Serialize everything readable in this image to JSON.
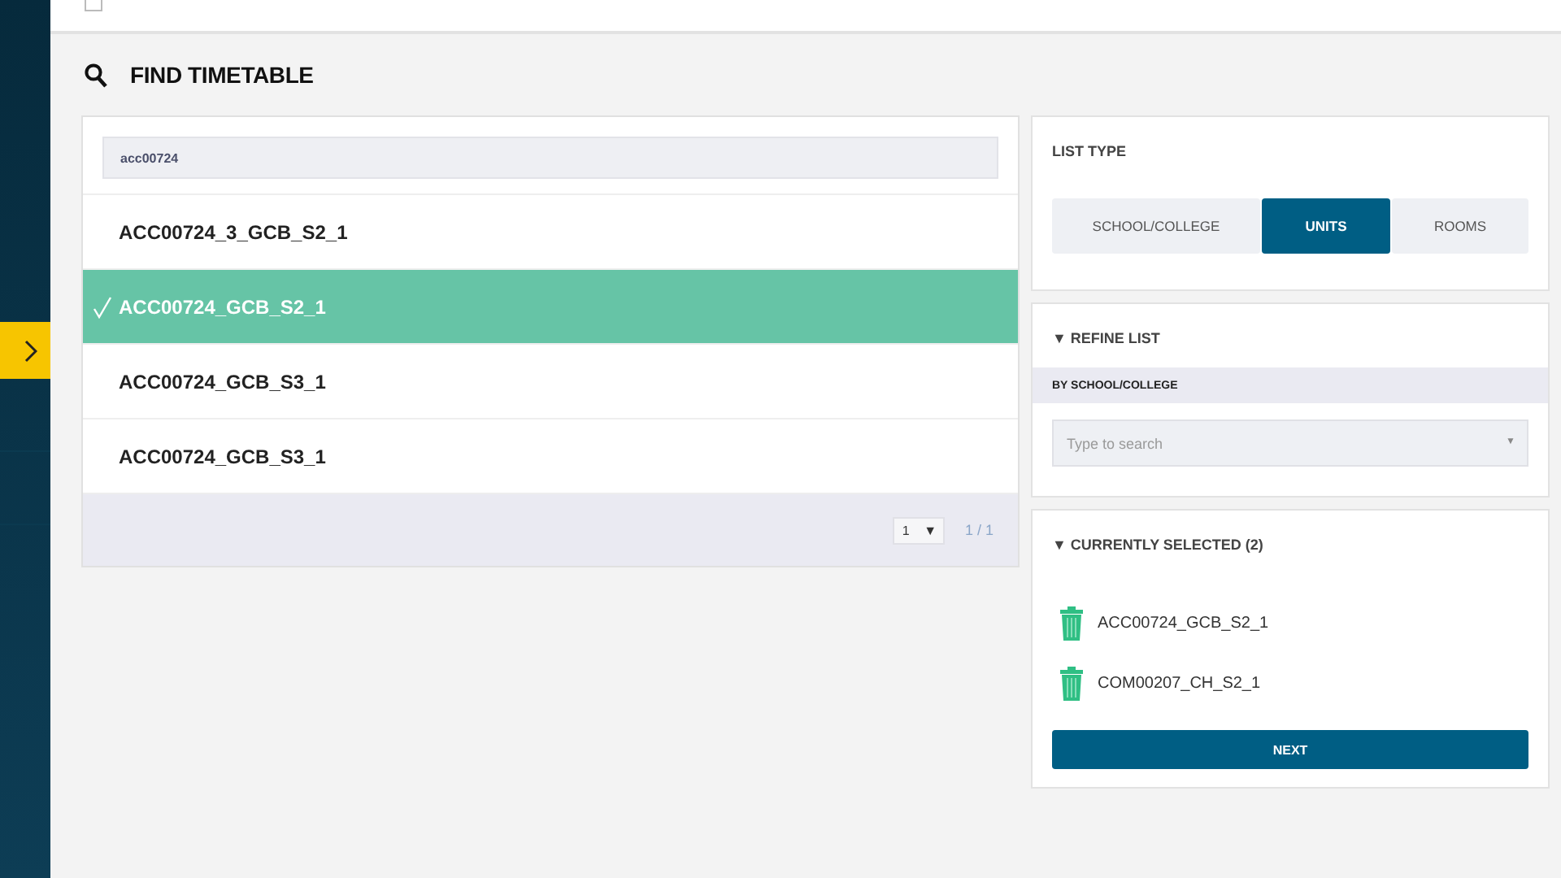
{
  "header": {
    "checkbox": {
      "checked": false
    }
  },
  "sidebar": {
    "items": [
      {
        "kind": "expand",
        "selected": true
      }
    ]
  },
  "page": {
    "title": "FIND TIMETABLE"
  },
  "search": {
    "value": "acc00724"
  },
  "results": [
    {
      "label": "ACC00724_3_GCB_S2_1",
      "selected": false
    },
    {
      "label": "ACC00724_GCB_S2_1",
      "selected": true
    },
    {
      "label": "ACC00724_GCB_S3_1",
      "selected": false
    },
    {
      "label": "ACC00724_GCB_S3_1",
      "selected": false
    }
  ],
  "pagination": {
    "page": "1",
    "caret": "▼",
    "count": "1 / 1"
  },
  "list_type": {
    "title": "LIST TYPE",
    "options": [
      {
        "label": "SCHOOL/COLLEGE",
        "selected": false
      },
      {
        "label": "UNITS",
        "selected": true
      },
      {
        "label": "ROOMS",
        "selected": false
      }
    ]
  },
  "refine": {
    "title": "▼ REFINE LIST",
    "subheading": "BY SCHOOL/COLLEGE",
    "placeholder": "Type to search",
    "caret": "▼"
  },
  "currently_selected": {
    "title": "▼ CURRENTLY SELECTED (2)",
    "items": [
      "ACC00724_GCB_S2_1",
      "COM00207_CH_S2_1"
    ],
    "button": "NEXT"
  }
}
